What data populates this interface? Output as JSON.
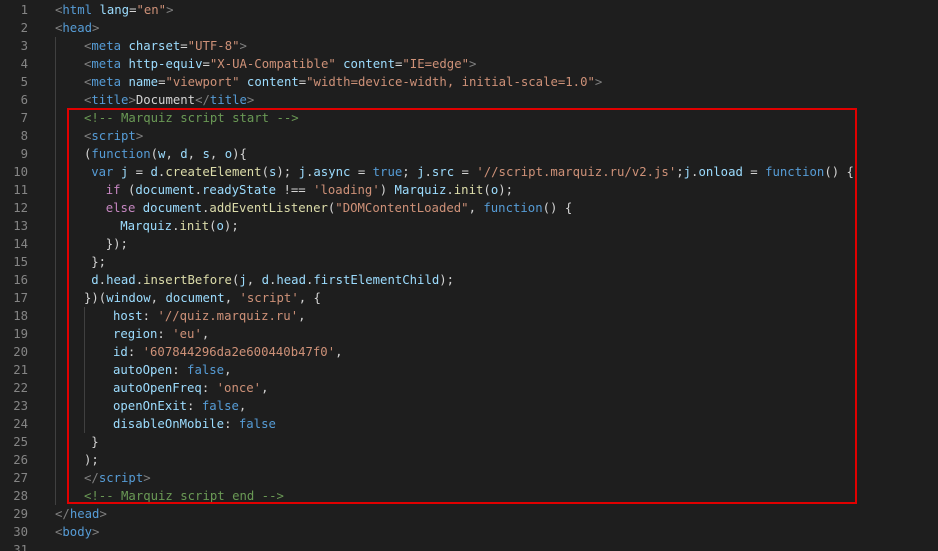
{
  "editor": {
    "language": "html",
    "lines": [
      {
        "n": "1",
        "indent": 0,
        "tokens": [
          [
            "bracket",
            "<"
          ],
          [
            "tag",
            "html"
          ],
          [
            "punc",
            " "
          ],
          [
            "attr",
            "lang"
          ],
          [
            "punc",
            "="
          ],
          [
            "str",
            "\"en\""
          ],
          [
            "bracket",
            ">"
          ]
        ]
      },
      {
        "n": "2",
        "indent": 0,
        "tokens": [
          [
            "bracket",
            "<"
          ],
          [
            "tag",
            "head"
          ],
          [
            "bracket",
            ">"
          ]
        ]
      },
      {
        "n": "3",
        "indent": 1,
        "tokens": [
          [
            "bracket",
            "<"
          ],
          [
            "tag",
            "meta"
          ],
          [
            "punc",
            " "
          ],
          [
            "attr",
            "charset"
          ],
          [
            "punc",
            "="
          ],
          [
            "str",
            "\"UTF-8\""
          ],
          [
            "bracket",
            ">"
          ]
        ]
      },
      {
        "n": "4",
        "indent": 1,
        "tokens": [
          [
            "bracket",
            "<"
          ],
          [
            "tag",
            "meta"
          ],
          [
            "punc",
            " "
          ],
          [
            "attr",
            "http-equiv"
          ],
          [
            "punc",
            "="
          ],
          [
            "str",
            "\"X-UA-Compatible\""
          ],
          [
            "punc",
            " "
          ],
          [
            "attr",
            "content"
          ],
          [
            "punc",
            "="
          ],
          [
            "str",
            "\"IE=edge\""
          ],
          [
            "bracket",
            ">"
          ]
        ]
      },
      {
        "n": "5",
        "indent": 1,
        "tokens": [
          [
            "bracket",
            "<"
          ],
          [
            "tag",
            "meta"
          ],
          [
            "punc",
            " "
          ],
          [
            "attr",
            "name"
          ],
          [
            "punc",
            "="
          ],
          [
            "str",
            "\"viewport\""
          ],
          [
            "punc",
            " "
          ],
          [
            "attr",
            "content"
          ],
          [
            "punc",
            "="
          ],
          [
            "str",
            "\"width=device-width, initial-scale=1.0\""
          ],
          [
            "bracket",
            ">"
          ]
        ]
      },
      {
        "n": "6",
        "indent": 1,
        "tokens": [
          [
            "bracket",
            "<"
          ],
          [
            "tag",
            "title"
          ],
          [
            "bracket",
            ">"
          ],
          [
            "punc",
            "Document"
          ],
          [
            "bracket",
            "</"
          ],
          [
            "tag",
            "title"
          ],
          [
            "bracket",
            ">"
          ]
        ]
      },
      {
        "n": "7",
        "indent": 1,
        "tokens": [
          [
            "cmt",
            "<!-- Marquiz script start -->"
          ]
        ]
      },
      {
        "n": "8",
        "indent": 1,
        "tokens": [
          [
            "bracket",
            "<"
          ],
          [
            "tag",
            "script"
          ],
          [
            "bracket",
            ">"
          ]
        ]
      },
      {
        "n": "9",
        "indent": 1,
        "tokens": [
          [
            "punc",
            "("
          ],
          [
            "kw",
            "function"
          ],
          [
            "punc",
            "("
          ],
          [
            "var",
            "w"
          ],
          [
            "punc",
            ", "
          ],
          [
            "var",
            "d"
          ],
          [
            "punc",
            ", "
          ],
          [
            "var",
            "s"
          ],
          [
            "punc",
            ", "
          ],
          [
            "var",
            "o"
          ],
          [
            "punc",
            "){"
          ]
        ]
      },
      {
        "n": "10",
        "indent": 1,
        "extra": 1,
        "tokens": [
          [
            "kw",
            "var"
          ],
          [
            "punc",
            " "
          ],
          [
            "var",
            "j"
          ],
          [
            "punc",
            " = "
          ],
          [
            "var",
            "d"
          ],
          [
            "punc",
            "."
          ],
          [
            "fn",
            "createElement"
          ],
          [
            "punc",
            "("
          ],
          [
            "var",
            "s"
          ],
          [
            "punc",
            "); "
          ],
          [
            "var",
            "j"
          ],
          [
            "punc",
            "."
          ],
          [
            "var",
            "async"
          ],
          [
            "punc",
            " = "
          ],
          [
            "kw",
            "true"
          ],
          [
            "punc",
            "; "
          ],
          [
            "var",
            "j"
          ],
          [
            "punc",
            "."
          ],
          [
            "var",
            "src"
          ],
          [
            "punc",
            " = "
          ],
          [
            "str",
            "'//script.marquiz.ru/v2.js'"
          ],
          [
            "punc",
            ";"
          ],
          [
            "var",
            "j"
          ],
          [
            "punc",
            "."
          ],
          [
            "var",
            "onload"
          ],
          [
            "punc",
            " = "
          ],
          [
            "kw",
            "function"
          ],
          [
            "punc",
            "() {"
          ]
        ]
      },
      {
        "n": "11",
        "indent": 1,
        "extra": 3,
        "tokens": [
          [
            "ctl",
            "if"
          ],
          [
            "punc",
            " ("
          ],
          [
            "var",
            "document"
          ],
          [
            "punc",
            "."
          ],
          [
            "var",
            "readyState"
          ],
          [
            "punc",
            " !== "
          ],
          [
            "str",
            "'loading'"
          ],
          [
            "punc",
            ") "
          ],
          [
            "var",
            "Marquiz"
          ],
          [
            "punc",
            "."
          ],
          [
            "fn",
            "init"
          ],
          [
            "punc",
            "("
          ],
          [
            "var",
            "o"
          ],
          [
            "punc",
            ");"
          ]
        ]
      },
      {
        "n": "12",
        "indent": 1,
        "extra": 3,
        "tokens": [
          [
            "ctl",
            "else"
          ],
          [
            "punc",
            " "
          ],
          [
            "var",
            "document"
          ],
          [
            "punc",
            "."
          ],
          [
            "fn",
            "addEventListener"
          ],
          [
            "punc",
            "("
          ],
          [
            "str",
            "\"DOMContentLoaded\""
          ],
          [
            "punc",
            ", "
          ],
          [
            "kw",
            "function"
          ],
          [
            "punc",
            "() {"
          ]
        ]
      },
      {
        "n": "13",
        "indent": 1,
        "extra": 5,
        "tokens": [
          [
            "var",
            "Marquiz"
          ],
          [
            "punc",
            "."
          ],
          [
            "fn",
            "init"
          ],
          [
            "punc",
            "("
          ],
          [
            "var",
            "o"
          ],
          [
            "punc",
            ");"
          ]
        ]
      },
      {
        "n": "14",
        "indent": 1,
        "extra": 3,
        "tokens": [
          [
            "punc",
            "});"
          ]
        ]
      },
      {
        "n": "15",
        "indent": 1,
        "extra": 1,
        "tokens": [
          [
            "punc",
            "};"
          ]
        ]
      },
      {
        "n": "16",
        "indent": 1,
        "extra": 1,
        "tokens": [
          [
            "var",
            "d"
          ],
          [
            "punc",
            "."
          ],
          [
            "var",
            "head"
          ],
          [
            "punc",
            "."
          ],
          [
            "fn",
            "insertBefore"
          ],
          [
            "punc",
            "("
          ],
          [
            "var",
            "j"
          ],
          [
            "punc",
            ", "
          ],
          [
            "var",
            "d"
          ],
          [
            "punc",
            "."
          ],
          [
            "var",
            "head"
          ],
          [
            "punc",
            "."
          ],
          [
            "var",
            "firstElementChild"
          ],
          [
            "punc",
            ");"
          ]
        ]
      },
      {
        "n": "17",
        "indent": 1,
        "tokens": [
          [
            "punc",
            "})("
          ],
          [
            "var",
            "window"
          ],
          [
            "punc",
            ", "
          ],
          [
            "var",
            "document"
          ],
          [
            "punc",
            ", "
          ],
          [
            "str",
            "'script'"
          ],
          [
            "punc",
            ", {"
          ]
        ]
      },
      {
        "n": "18",
        "indent": 2,
        "tokens": [
          [
            "var",
            "host"
          ],
          [
            "punc",
            ": "
          ],
          [
            "str",
            "'//quiz.marquiz.ru'"
          ],
          [
            "punc",
            ","
          ]
        ]
      },
      {
        "n": "19",
        "indent": 2,
        "tokens": [
          [
            "var",
            "region"
          ],
          [
            "punc",
            ": "
          ],
          [
            "str",
            "'eu'"
          ],
          [
            "punc",
            ","
          ]
        ]
      },
      {
        "n": "20",
        "indent": 2,
        "tokens": [
          [
            "var",
            "id"
          ],
          [
            "punc",
            ": "
          ],
          [
            "str",
            "'607844296da2e600440b47f0'"
          ],
          [
            "punc",
            ","
          ]
        ]
      },
      {
        "n": "21",
        "indent": 2,
        "tokens": [
          [
            "var",
            "autoOpen"
          ],
          [
            "punc",
            ": "
          ],
          [
            "kw",
            "false"
          ],
          [
            "punc",
            ","
          ]
        ]
      },
      {
        "n": "22",
        "indent": 2,
        "tokens": [
          [
            "var",
            "autoOpenFreq"
          ],
          [
            "punc",
            ": "
          ],
          [
            "str",
            "'once'"
          ],
          [
            "punc",
            ","
          ]
        ]
      },
      {
        "n": "23",
        "indent": 2,
        "tokens": [
          [
            "var",
            "openOnExit"
          ],
          [
            "punc",
            ": "
          ],
          [
            "kw",
            "false"
          ],
          [
            "punc",
            ","
          ]
        ]
      },
      {
        "n": "24",
        "indent": 2,
        "tokens": [
          [
            "var",
            "disableOnMobile"
          ],
          [
            "punc",
            ": "
          ],
          [
            "kw",
            "false"
          ]
        ]
      },
      {
        "n": "25",
        "indent": 1,
        "extra": 1,
        "tokens": [
          [
            "punc",
            "}"
          ]
        ]
      },
      {
        "n": "26",
        "indent": 1,
        "tokens": [
          [
            "punc",
            ");"
          ]
        ]
      },
      {
        "n": "27",
        "indent": 1,
        "tokens": [
          [
            "bracket",
            "</"
          ],
          [
            "tag",
            "script"
          ],
          [
            "bracket",
            ">"
          ]
        ]
      },
      {
        "n": "28",
        "indent": 1,
        "tokens": [
          [
            "cmt",
            "<!-- Marquiz script end -->"
          ]
        ]
      },
      {
        "n": "29",
        "indent": 0,
        "tokens": [
          [
            "bracket",
            "</"
          ],
          [
            "tag",
            "head"
          ],
          [
            "bracket",
            ">"
          ]
        ]
      },
      {
        "n": "30",
        "indent": 0,
        "tokens": [
          [
            "bracket",
            "<"
          ],
          [
            "tag",
            "body"
          ],
          [
            "bracket",
            ">"
          ]
        ]
      },
      {
        "n": "31",
        "indent": 0,
        "tokens": []
      }
    ]
  },
  "highlight": {
    "color": "#e10000",
    "covers_lines": "7-28"
  }
}
